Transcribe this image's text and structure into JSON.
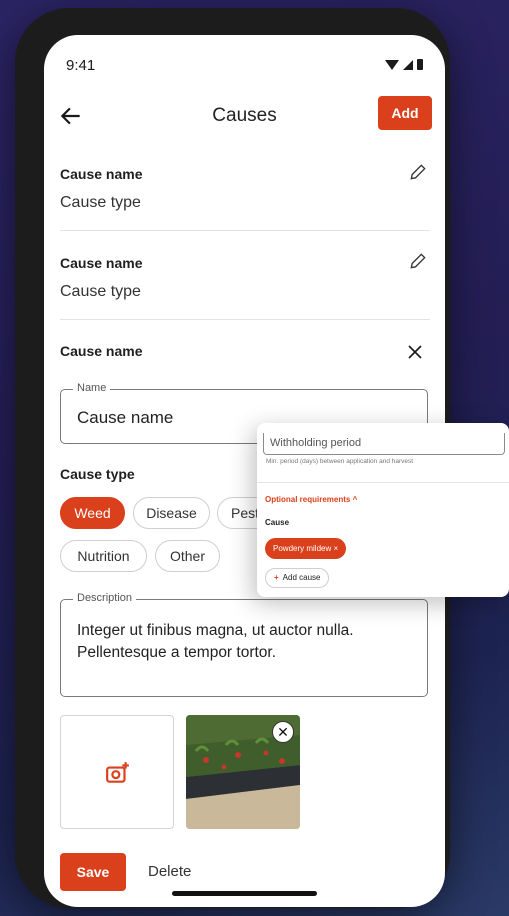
{
  "status_bar": {
    "time": "9:41"
  },
  "app_bar": {
    "title": "Causes",
    "add_label": "Add"
  },
  "causes": [
    {
      "name": "Cause name",
      "type": "Cause type"
    },
    {
      "name": "Cause name",
      "type": "Cause type"
    }
  ],
  "editor": {
    "header": "Cause name",
    "name_field": {
      "label": "Name",
      "value": "Cause name"
    },
    "type_label": "Cause type",
    "type_chips": [
      "Weed",
      "Disease",
      "Pest",
      "Nutrition",
      "Other"
    ],
    "selected_type": "Weed",
    "description_field": {
      "label": "Description",
      "value": "Integer ut finibus magna, ut auctor nulla. Pellentesque a tempor tortor."
    },
    "remove_photo_symbol": "✕"
  },
  "actions": {
    "save_label": "Save",
    "delete_label": "Delete"
  },
  "overlay": {
    "withholding_placeholder": "Withholding period",
    "withholding_help": "Min. period (days) between application and harvest",
    "optional_label": "Optional requirements",
    "cause_label": "Cause",
    "cause_chip": "Powdery mildew",
    "add_cause_label": "Add cause"
  },
  "colors": {
    "accent": "#d9401b",
    "background": "#241e55"
  }
}
